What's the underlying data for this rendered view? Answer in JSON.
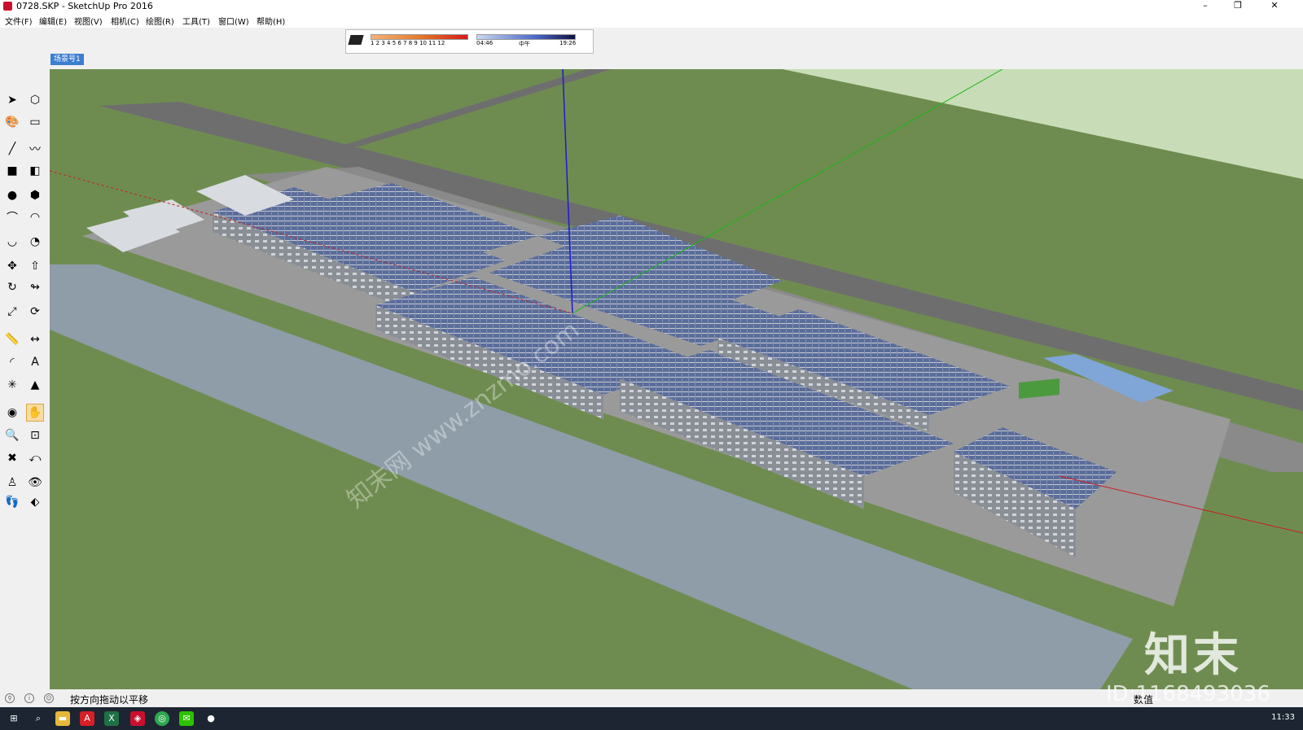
{
  "window": {
    "title": "0728.SKP - SketchUp Pro 2016",
    "minimize_label": "–",
    "restore_label": "❐",
    "close_label": "✕"
  },
  "menu": [
    {
      "label": "文件(F)"
    },
    {
      "label": "编辑(E)"
    },
    {
      "label": "视图(V)"
    },
    {
      "label": "相机(C)"
    },
    {
      "label": "绘图(R)"
    },
    {
      "label": "工具(T)"
    },
    {
      "label": "窗口(W)"
    },
    {
      "label": "帮助(H)"
    }
  ],
  "shadow_toolbar": {
    "months": "1 2 3 4 5 6 7 8 9 10 11 12",
    "time_start": "04:46",
    "time_mid": "中午",
    "time_end": "19:26"
  },
  "scene_tab": "场景号1",
  "tools": [
    {
      "name": "select-tool-icon",
      "glyph": "➤"
    },
    {
      "name": "component-tool-icon",
      "glyph": "⬡"
    },
    {
      "name": "paint-bucket-icon",
      "glyph": "🎨"
    },
    {
      "name": "eraser-icon",
      "glyph": "▭"
    },
    {
      "name": "line-tool-icon",
      "glyph": "╱"
    },
    {
      "name": "freehand-tool-icon",
      "glyph": "〰"
    },
    {
      "name": "rectangle-tool-icon",
      "glyph": "■"
    },
    {
      "name": "rotated-rectangle-icon",
      "glyph": "◧"
    },
    {
      "name": "circle-tool-icon",
      "glyph": "●"
    },
    {
      "name": "polygon-tool-icon",
      "glyph": "⬢"
    },
    {
      "name": "arc-tool-icon",
      "glyph": "⌒"
    },
    {
      "name": "two-point-arc-icon",
      "glyph": "◠"
    },
    {
      "name": "three-point-arc-icon",
      "glyph": "◡"
    },
    {
      "name": "pie-tool-icon",
      "glyph": "◔"
    },
    {
      "name": "move-tool-icon",
      "glyph": "✥"
    },
    {
      "name": "push-pull-icon",
      "glyph": "⇧"
    },
    {
      "name": "rotate-tool-icon",
      "glyph": "↻"
    },
    {
      "name": "follow-me-icon",
      "glyph": "↬"
    },
    {
      "name": "scale-tool-icon",
      "glyph": "⤢"
    },
    {
      "name": "offset-tool-icon",
      "glyph": "⟳"
    },
    {
      "name": "tape-measure-icon",
      "glyph": "📏"
    },
    {
      "name": "dimension-tool-icon",
      "glyph": "↔"
    },
    {
      "name": "protractor-icon",
      "glyph": "◜"
    },
    {
      "name": "text-tool-icon",
      "glyph": "A"
    },
    {
      "name": "axes-tool-icon",
      "glyph": "✳"
    },
    {
      "name": "3d-text-icon",
      "glyph": "▲"
    },
    {
      "name": "orbit-tool-icon",
      "glyph": "◉"
    },
    {
      "name": "pan-tool-icon",
      "glyph": "✋"
    },
    {
      "name": "zoom-tool-icon",
      "glyph": "🔍"
    },
    {
      "name": "zoom-window-icon",
      "glyph": "⊡"
    },
    {
      "name": "zoom-extents-icon",
      "glyph": "✖"
    },
    {
      "name": "previous-view-icon",
      "glyph": "⤺"
    },
    {
      "name": "position-camera-icon",
      "glyph": "♙"
    },
    {
      "name": "look-around-icon",
      "glyph": "👁"
    },
    {
      "name": "walk-tool-icon",
      "glyph": "👣"
    },
    {
      "name": "section-plane-icon",
      "glyph": "⬖"
    }
  ],
  "status": {
    "hint": "按方向拖动以平移",
    "vcb_label": "数值"
  },
  "taskbar": {
    "clock": "11:33"
  },
  "watermark": {
    "logo": "知末",
    "id": "ID:1168493036",
    "diagonal": "知末网 www.znzmo.com"
  },
  "colors": {
    "grass": "#6f8c50",
    "grass_light": "#c8ddb7",
    "road": "#6e6e6e",
    "canal": "#8e9da8",
    "roof_solar": "#5b6d9a",
    "building": "#c8ccd1",
    "axis_blue": "#1b1bd0",
    "axis_green": "#18b818",
    "axis_red": "#c81e1e"
  }
}
